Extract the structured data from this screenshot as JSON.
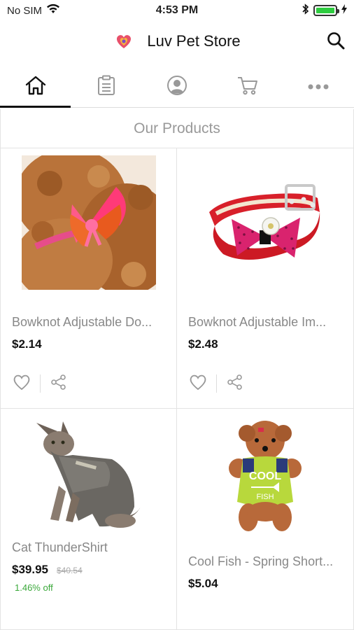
{
  "status_bar": {
    "carrier": "No SIM",
    "time": "4:53 PM"
  },
  "header": {
    "title": "Luv Pet Store",
    "logo_text": "LuvPet Store"
  },
  "tabs": [
    {
      "name": "home",
      "icon": "home-icon",
      "active": true
    },
    {
      "name": "orders",
      "icon": "clipboard-icon",
      "active": false
    },
    {
      "name": "account",
      "icon": "user-icon",
      "active": false
    },
    {
      "name": "cart",
      "icon": "cart-icon",
      "active": false
    },
    {
      "name": "more",
      "icon": "more-icon",
      "active": false
    }
  ],
  "section": {
    "title": "Our Products"
  },
  "products": [
    {
      "name": "Bowknot Adjustable Do...",
      "price": "$2.14",
      "image": "dog-with-bow"
    },
    {
      "name": "Bowknot Adjustable Im...",
      "price": "$2.48",
      "image": "red-collar-bowtie"
    },
    {
      "name": "Cat ThunderShirt",
      "price": "$39.95",
      "old_price": "$40.54",
      "discount": "1.46% off",
      "image": "cat-thundershirt"
    },
    {
      "name": "Cool Fish - Spring Short...",
      "price": "$5.04",
      "image": "dog-cool-fish-shirt"
    }
  ],
  "colors": {
    "accent": "#111111",
    "discount": "#3aa83a",
    "muted_text": "#888888"
  }
}
